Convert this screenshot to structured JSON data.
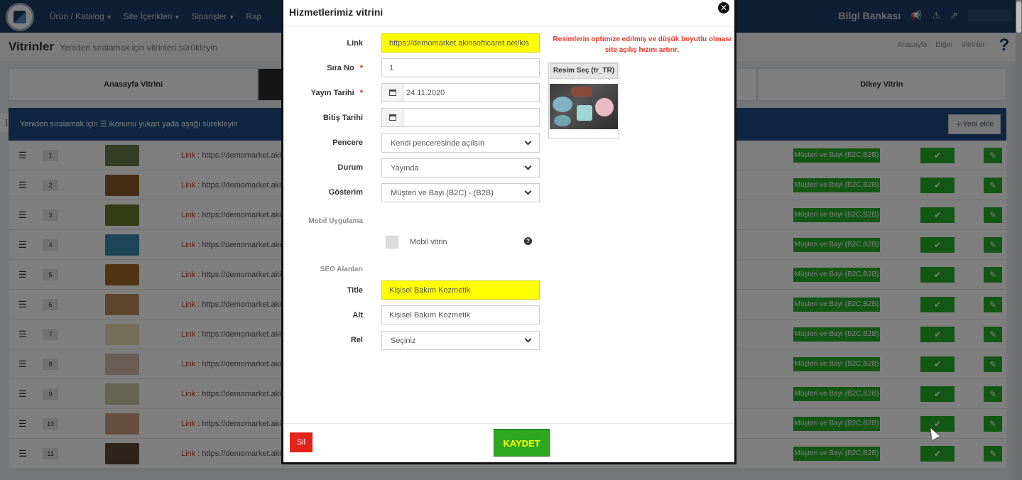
{
  "header": {
    "nav": [
      "Ürün / Katalog",
      "Site İçerikleri",
      "Siparişler",
      "Rap"
    ],
    "knowledge_base": "Bilgi Bankası"
  },
  "page": {
    "title": "Vitrinler",
    "subtitle": "Yeniden sıralamak için vitrinleri sürükleyin",
    "breadcrumb": [
      "Anasayfa",
      "Diğer",
      "Vitrinler"
    ]
  },
  "tabs": [
    "Anasayfa Vitrini",
    "",
    "",
    "Dikey Vitrin"
  ],
  "list": {
    "hint": "Yeniden sıralamak için ☰ ikonunu yukarı yada aşağı sürekleyin",
    "new_button": "Yeni ekle",
    "link_prefix": "Link",
    "link_text": "https://demomarket.akins",
    "customer_badge": "Müşteri ve Bayi (B2C,B2B)",
    "rows": [
      "1",
      "2",
      "3",
      "4",
      "5",
      "6",
      "7",
      "8",
      "9",
      "10",
      "11"
    ]
  },
  "modal": {
    "title": "Hizmetlerimiz vitrini",
    "fields": {
      "link_label": "Link",
      "link_value": "https://demomarket.akinsofticaret.net/kis",
      "order_label": "Sıra No",
      "order_value": "1",
      "publish_label": "Yayın Tarihi",
      "publish_value": "24.11.2020",
      "end_label": "Bitiş Tarihi",
      "end_value": "",
      "window_label": "Pencere",
      "window_value": "Kendi penceresinde açılsın",
      "status_label": "Durum",
      "status_value": "Yayında",
      "show_label": "Gösterim",
      "show_value": "Müşteri ve Bayi (B2C) - (B2B)"
    },
    "mobile_section": "Mobil Uygulama",
    "mobile_checkbox_label": "Mobil vitrin",
    "seo_section": "SEO Alanları",
    "seo": {
      "title_label": "Title",
      "title_value": "Kişisel Bakım Kozmetik",
      "alt_label": "Alt",
      "alt_value": "Kişisel Bakım Kozmetik",
      "rel_label": "Rel",
      "rel_value": "Seçiniz"
    },
    "warning": "Resimlerin optimize edilmiş ve düşük boyutlu olması site açılış hızını artırır.",
    "image_button": "Resim Seç (tr_TR)",
    "delete_button": "Sil",
    "save_button": "KAYDET"
  },
  "colors": {
    "topbar": "#1e3d64",
    "panel_head": "#1f4d86",
    "highlight": "#ffff00",
    "success": "#27ae28",
    "danger": "#e3241b",
    "warning_text": "#e03a2c"
  }
}
